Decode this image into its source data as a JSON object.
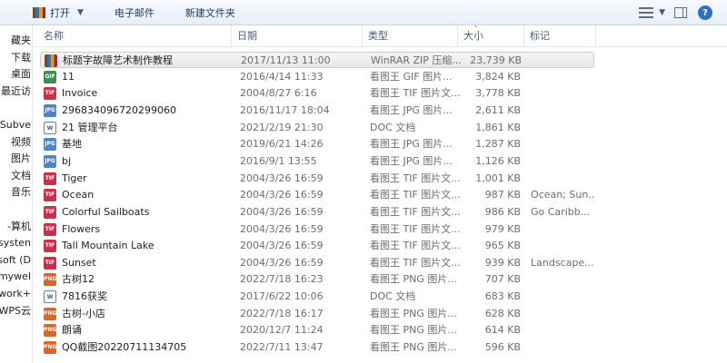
{
  "toolbar": {
    "open_label": "打开",
    "email_label": "电子邮件",
    "new_folder_label": "新建文件夹"
  },
  "nav": {
    "items": [
      "藏夹",
      "下载",
      "桌面",
      "最近访",
      "",
      "Subve",
      "视频",
      "图片",
      "文档",
      "音乐",
      "",
      "-算机",
      "systen",
      "soft (D",
      "mywel",
      "work+",
      "WPS云"
    ]
  },
  "columns": {
    "name": "名称",
    "date": "日期",
    "type": "类型",
    "size": "大小",
    "tags": "标记"
  },
  "files": [
    {
      "name": "标题字故障艺术制作教程",
      "date": "2017/11/13 11:00",
      "type": "WinRAR ZIP 压缩...",
      "size": "23,739 KB",
      "tags": "",
      "icon": "zip",
      "icon_text": ""
    },
    {
      "name": "11",
      "date": "2016/4/14 11:33",
      "type": "看图王 GIF 图片...",
      "size": "3,824 KB",
      "tags": "",
      "icon": "gif",
      "icon_text": "GIF"
    },
    {
      "name": "Invoice",
      "date": "2004/8/27 6:16",
      "type": "看图王 TIF 图片文...",
      "size": "3,778 KB",
      "tags": "",
      "icon": "tif",
      "icon_text": "TIF"
    },
    {
      "name": "296834096720299060",
      "date": "2016/11/17 18:04",
      "type": "看图王 JPG 图片...",
      "size": "2,611 KB",
      "tags": "",
      "icon": "jpg",
      "icon_text": "JPG"
    },
    {
      "name": "21 管理平台",
      "date": "2021/2/19 21:30",
      "type": "DOC 文档",
      "size": "1,861 KB",
      "tags": "",
      "icon": "doc",
      "icon_text": "W"
    },
    {
      "name": "基地",
      "date": "2019/6/21 14:26",
      "type": "看图王 JPG 图片...",
      "size": "1,287 KB",
      "tags": "",
      "icon": "jpg",
      "icon_text": "JPG"
    },
    {
      "name": "bj",
      "date": "2016/9/1 13:55",
      "type": "看图王 JPG 图片...",
      "size": "1,126 KB",
      "tags": "",
      "icon": "jpg",
      "icon_text": "JPG"
    },
    {
      "name": "Tiger",
      "date": "2004/3/26 16:59",
      "type": "看图王 TIF 图片文...",
      "size": "1,001 KB",
      "tags": "",
      "icon": "tif",
      "icon_text": "TIF"
    },
    {
      "name": "Ocean",
      "date": "2004/3/26 16:59",
      "type": "看图王 TIF 图片文...",
      "size": "987 KB",
      "tags": "Ocean; Sun...",
      "icon": "tif",
      "icon_text": "TIF"
    },
    {
      "name": "Colorful Sailboats",
      "date": "2004/3/26 16:59",
      "type": "看图王 TIF 图片文...",
      "size": "986 KB",
      "tags": "Go Caribb...",
      "icon": "tif",
      "icon_text": "TIF"
    },
    {
      "name": "Flowers",
      "date": "2004/3/26 16:59",
      "type": "看图王 TIF 图片文...",
      "size": "979 KB",
      "tags": "",
      "icon": "tif",
      "icon_text": "TIF"
    },
    {
      "name": "Tall Mountain Lake",
      "date": "2004/3/26 16:59",
      "type": "看图王 TIF 图片文...",
      "size": "965 KB",
      "tags": "",
      "icon": "tif",
      "icon_text": "TIF"
    },
    {
      "name": "Sunset",
      "date": "2004/3/26 16:59",
      "type": "看图王 TIF 图片文...",
      "size": "939 KB",
      "tags": "Landscape...",
      "icon": "tif",
      "icon_text": "TIF"
    },
    {
      "name": "古树12",
      "date": "2022/7/18 16:23",
      "type": "看图王 PNG 图片...",
      "size": "707 KB",
      "tags": "",
      "icon": "png",
      "icon_text": "PNG"
    },
    {
      "name": "7816获奖",
      "date": "2017/6/22 10:06",
      "type": "DOC 文档",
      "size": "683 KB",
      "tags": "",
      "icon": "doc",
      "icon_text": "W"
    },
    {
      "name": "古树-小店",
      "date": "2022/7/18 16:17",
      "type": "看图王 PNG 图片...",
      "size": "628 KB",
      "tags": "",
      "icon": "png",
      "icon_text": "PNG"
    },
    {
      "name": "朗诵",
      "date": "2020/12/7 11:24",
      "type": "看图王 PNG 图片...",
      "size": "614 KB",
      "tags": "",
      "icon": "png",
      "icon_text": "PNG"
    },
    {
      "name": "QQ截图20220711134705",
      "date": "2022/7/11 13:47",
      "type": "看图王 PNG 图片...",
      "size": "596 KB",
      "tags": "",
      "icon": "png",
      "icon_text": "PNG"
    }
  ]
}
